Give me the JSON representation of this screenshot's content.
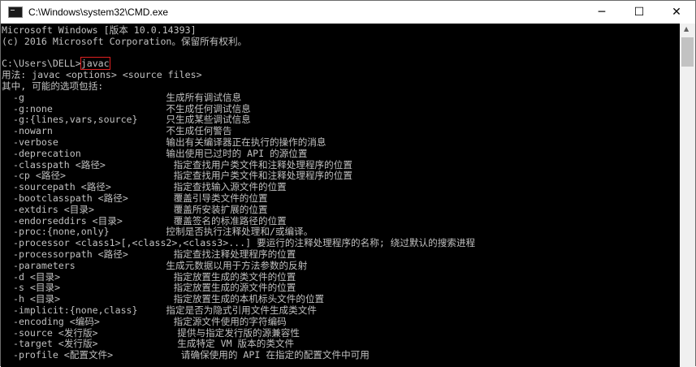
{
  "window": {
    "title": "C:\\Windows\\system32\\CMD.exe",
    "icon": "console-icon"
  },
  "controls": {
    "minimize": "─",
    "maximize": "☐",
    "close": "✕"
  },
  "console": {
    "line0": "Microsoft Windows [版本 10.0.14393]",
    "line1": "(c) 2016 Microsoft Corporation。保留所有权利。",
    "line2": "",
    "prompt": "C:\\Users\\DELL>",
    "command": "javac",
    "body": "用法: javac <options> <source files>\n其中, 可能的选项包括:\n  -g                         生成所有调试信息\n  -g:none                    不生成任何调试信息\n  -g:{lines,vars,source}     只生成某些调试信息\n  -nowarn                    不生成任何警告\n  -verbose                   输出有关编译器正在执行的操作的消息\n  -deprecation               输出使用已过时的 API 的源位置\n  -classpath <路径>            指定查找用户类文件和注释处理程序的位置\n  -cp <路径>                   指定查找用户类文件和注释处理程序的位置\n  -sourcepath <路径>           指定查找输入源文件的位置\n  -bootclasspath <路径>        覆盖引导类文件的位置\n  -extdirs <目录>              覆盖所安装扩展的位置\n  -endorseddirs <目录>         覆盖签名的标准路径的位置\n  -proc:{none,only}          控制是否执行注释处理和/或编译。\n  -processor <class1>[,<class2>,<class3>...] 要运行的注释处理程序的名称; 绕过默认的搜索进程\n  -processorpath <路径>        指定查找注释处理程序的位置\n  -parameters                生成元数据以用于方法参数的反射\n  -d <目录>                    指定放置生成的类文件的位置\n  -s <目录>                    指定放置生成的源文件的位置\n  -h <目录>                    指定放置生成的本机标头文件的位置\n  -implicit:{none,class}     指定是否为隐式引用文件生成类文件\n  -encoding <编码>             指定源文件使用的字符编码\n  -source <发行版>              提供与指定发行版的源兼容性\n  -target <发行版>              生成特定 VM 版本的类文件\n  -profile <配置文件>            请确保使用的 API 在指定的配置文件中可用"
  }
}
